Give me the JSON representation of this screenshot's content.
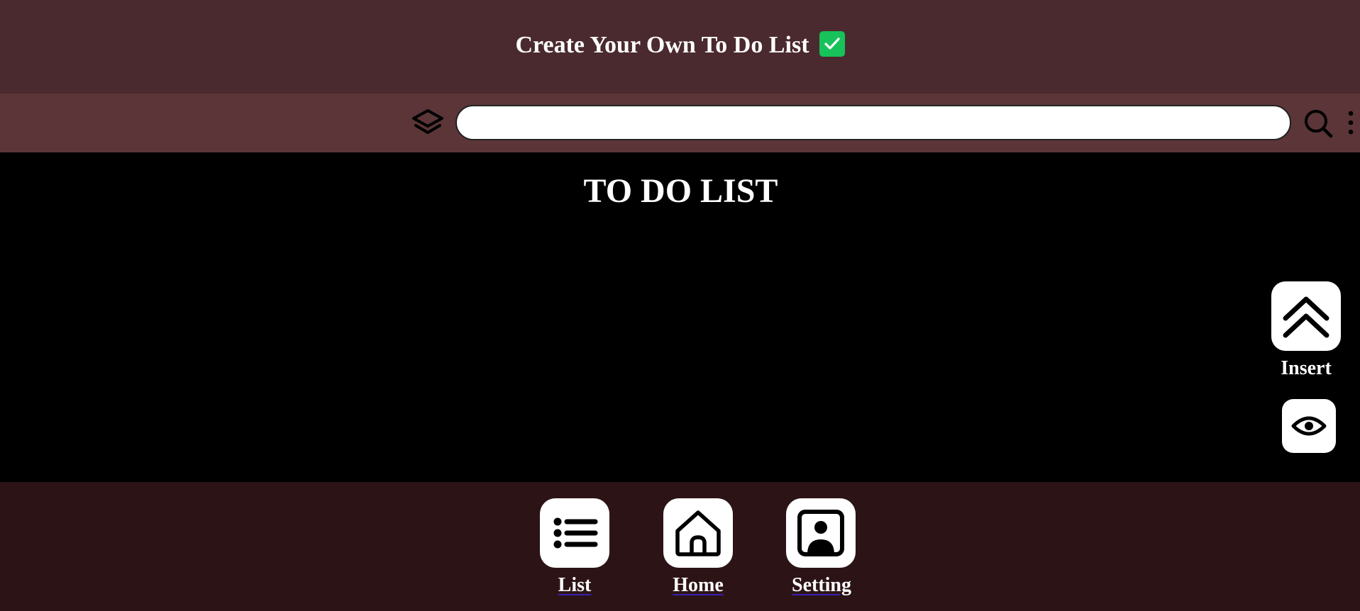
{
  "header": {
    "title": "Create Your Own To Do List",
    "check_icon": "check-box-icon",
    "check_color": "#18c25a"
  },
  "toolbar": {
    "layers_icon": "layers-icon",
    "search_placeholder": "",
    "search_icon": "search-icon",
    "more_icon": "more-vertical-icon"
  },
  "main": {
    "title": "TO DO LIST"
  },
  "side_actions": {
    "insert_label": "Insert",
    "insert_icon": "chevrons-up-icon",
    "view_icon": "eye-icon"
  },
  "bottom_nav": {
    "items": [
      {
        "label": "List",
        "icon": "list-icon"
      },
      {
        "label": "Home",
        "icon": "home-icon"
      },
      {
        "label": "Setting",
        "icon": "user-square-icon"
      }
    ]
  },
  "colors": {
    "header_bg": "#4a2a2e",
    "toolbar_bg": "#5c3538",
    "main_bg": "#000000",
    "bottom_bg": "#2c1416"
  }
}
